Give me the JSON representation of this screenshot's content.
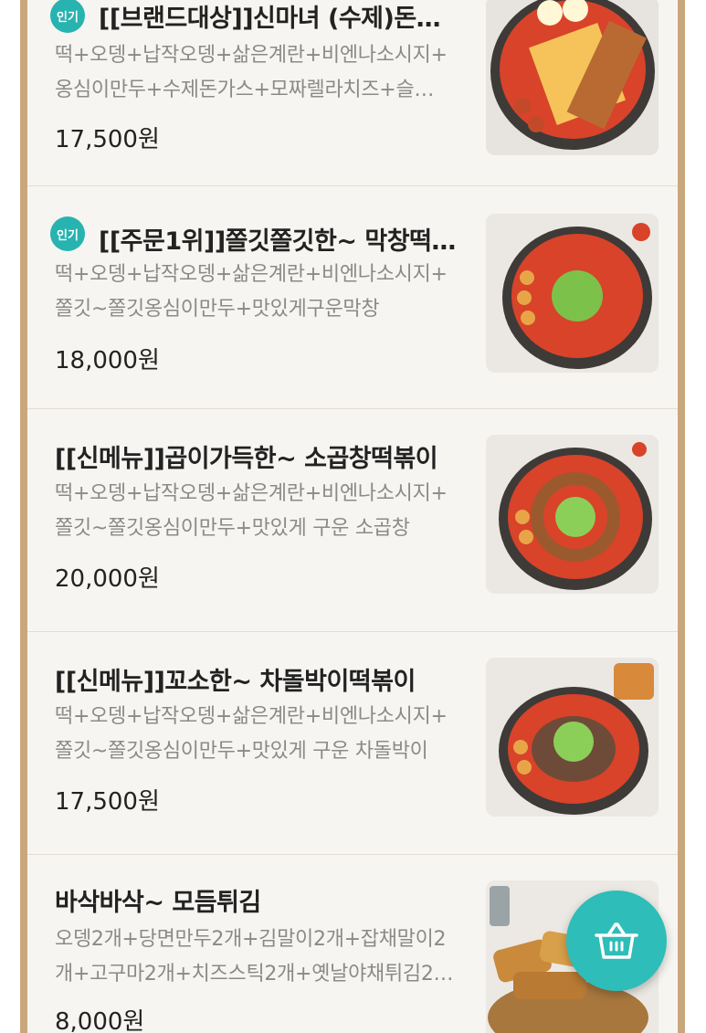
{
  "colors": {
    "accent": "#27b3b0",
    "border": "#c9a77d",
    "background": "#f7f5f1",
    "title": "#222222",
    "description": "#8a8a8a"
  },
  "badge_label": "인기",
  "menu_items": [
    {
      "title": "[[브랜드대상]]신마녀 (수제)돈…",
      "badge": true,
      "desc_line1": "떡+오뎅+납작오뎅+삶은계란+비엔나소시지+",
      "desc_line2": "옹심이만두+수제돈가스+모짜렐라치즈+슬…",
      "price": "17,500원"
    },
    {
      "title": "[[주문1위]]쫄깃쫄깃한~ 막창떡…",
      "badge": true,
      "desc_line1": "떡+오뎅+납작오뎅+삶은계란+비엔나소시지+",
      "desc_line2": "쫄깃~쫄깃옹심이만두+맛있게구운막창",
      "price": "18,000원"
    },
    {
      "title": "[[신메뉴]]곱이가득한~ 소곱창떡볶이",
      "badge": false,
      "desc_line1": "떡+오뎅+납작오뎅+삶은계란+비엔나소시지+",
      "desc_line2": "쫄깃~쫄깃옹심이만두+맛있게 구운 소곱창",
      "price": "20,000원"
    },
    {
      "title": "[[신메뉴]]꼬소한~ 차돌박이떡볶이",
      "badge": false,
      "desc_line1": "떡+오뎅+납작오뎅+삶은계란+비엔나소시지+",
      "desc_line2": "쫄깃~쫄깃옹심이만두+맛있게 구운 차돌박이",
      "price": "17,500원"
    },
    {
      "title": "바삭바삭~ 모듬튀김",
      "badge": false,
      "desc_line1": "오뎅2개+당면만두2개+김말이2개+잡채말이2",
      "desc_line2": "개+고구마2개+치즈스틱2개+옛날야채튀김2…",
      "price": "8,000원"
    }
  ],
  "cart_button_icon": "shopping-basket-icon"
}
